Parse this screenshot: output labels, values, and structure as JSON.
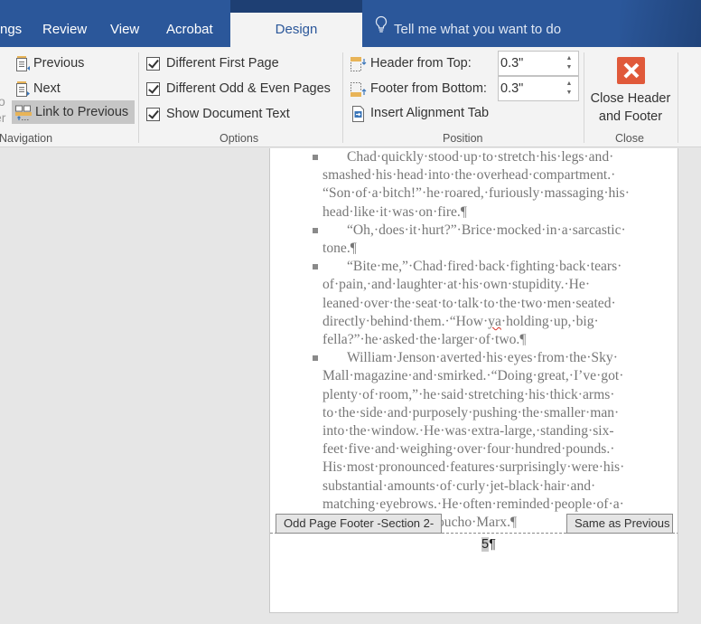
{
  "tabs": [
    {
      "label": "ngs",
      "active": false
    },
    {
      "label": "Review",
      "active": false
    },
    {
      "label": "View",
      "active": false
    },
    {
      "label": "Acrobat",
      "active": false
    },
    {
      "label": "Design",
      "active": true
    }
  ],
  "tell_me": {
    "icon": "lightbulb-icon",
    "placeholder": "Tell me what you want to do"
  },
  "colors": {
    "ribbon_blue": "#2b579a",
    "close_red": "#e0593a",
    "active_tab_bg": "#f3f3f3"
  },
  "ribbon": {
    "navigation": {
      "label": "Navigation",
      "partial_left_labels": [
        "o",
        "er"
      ],
      "buttons": [
        {
          "label": "Previous",
          "icon": "previous-section-icon"
        },
        {
          "label": "Next",
          "icon": "next-section-icon"
        },
        {
          "label": "Link to Previous",
          "icon": "link-to-previous-icon",
          "selected": true
        }
      ]
    },
    "options": {
      "label": "Options",
      "checkboxes": [
        {
          "label": "Different First Page",
          "checked": true
        },
        {
          "label": "Different Odd & Even Pages",
          "checked": true
        },
        {
          "label": "Show Document Text",
          "checked": true
        }
      ]
    },
    "position": {
      "label": "Position",
      "header_from_top": {
        "label": "Header from Top:",
        "value": "0.3\""
      },
      "footer_from_bottom": {
        "label": "Footer from Bottom:",
        "value": "0.3\""
      },
      "insert_alignment_tab": "Insert Alignment Tab"
    },
    "close": {
      "label": "Close",
      "button_line1": "Close Header",
      "button_line2": "and Footer"
    }
  },
  "document": {
    "paragraphs": [
      {
        "first_line": "Chad·quickly·stood·up·to·stretch·his·legs·and·",
        "rest": "smashed·his·head·into·the·overhead·compartment.· “Son·of·a·bitch!”·he·roared,·furiously·massaging·his· head·like·it·was·on·fire.¶"
      },
      {
        "first_line": "“Oh,·does·it·hurt?”·Brice·mocked·in·a·sarcastic·",
        "rest": "tone.¶"
      },
      {
        "first_line": "“Bite·me,”·Chad·fired·back·fighting·back·tears·",
        "rest_before": "of·pain,·and·laughter·at·his·own·stupidity.·He· leaned·over·the·seat·to·talk·to·the·two·men·seated· directly·behind·them.·“How·",
        "misspelled": "ya",
        "rest_after": "·holding·up,·big· fella?”·he·asked·the·larger·of·two.¶"
      },
      {
        "first_line": "William·Jenson·averted·his·eyes·from·the·Sky·",
        "rest": "Mall·magazine·and·smirked.·“Doing·great,·I’ve·got· plenty·of·room,”·he·said·stretching·his·thick·arms· to·the·side·and·purposely·pushing·the·smaller·man· into·the·window.·He·was·extra-large,·standing·six- feet·five·and·weighing·over·four·hundred·pounds.· His·most·pronounced·features·surprisingly·were·his· substantial·amounts·of·curly·jet-black·hair·and· matching·eyebrows.·He·often·reminded·people·of·a· larger·version·of·Groucho·Marx.¶"
      }
    ],
    "footer_tag": "Odd Page Footer -Section 2-",
    "same_as_previous": "Same as Previous",
    "page_number": "5",
    "pilcrow": "¶"
  }
}
